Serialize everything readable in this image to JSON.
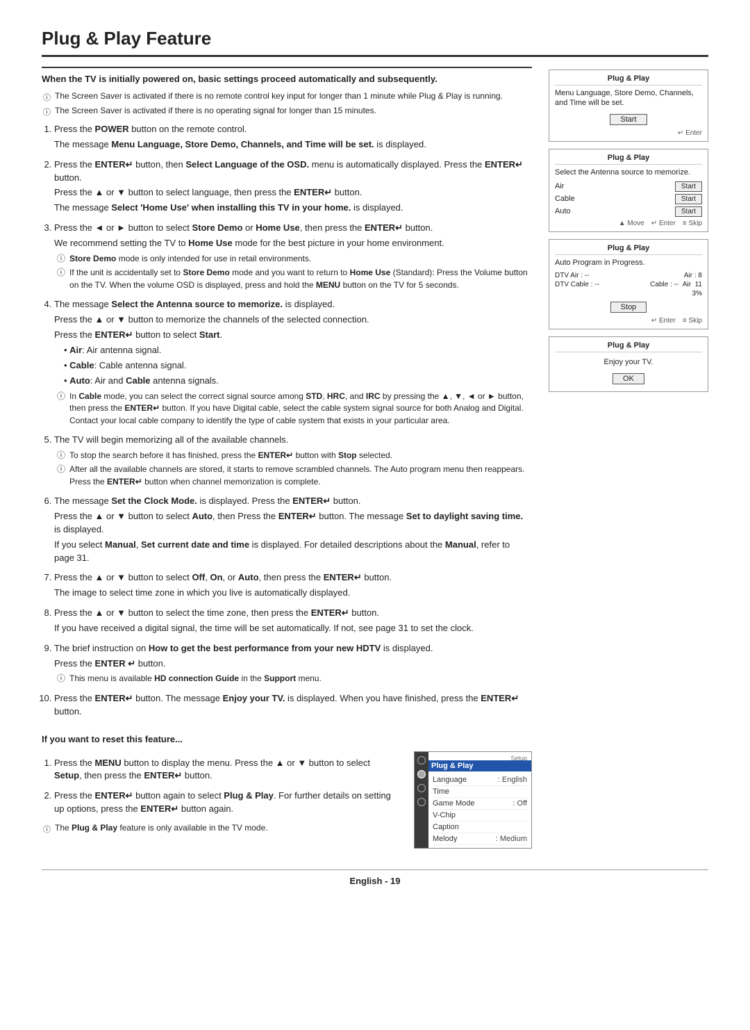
{
  "page": {
    "title": "Plug & Play Feature",
    "footer": "English - 19"
  },
  "intro": {
    "bold": "When the TV is initially powered on, basic settings proceed automatically and subsequently.",
    "notes": [
      "The Screen Saver is activated if there is no remote control key input for longer than 1 minute while Plug & Play is running.",
      "The Screen Saver is activated if there is no operating signal for longer than 15 minutes."
    ]
  },
  "steps": [
    {
      "num": "1",
      "lines": [
        "Press the POWER button on the remote control.",
        "The message Menu Language, Store Demo, Channels, and Time will be set. is displayed."
      ],
      "bold_parts": [
        "POWER",
        "Menu Language, Store Demo, Channels, and Time will be set."
      ]
    },
    {
      "num": "2",
      "lines": [
        "Press the ENTER button, then Select Language of the OSD. menu is automatically displayed. Press the ENTER button.",
        "Press the ▲ or ▼ button to select language, then press the ENTER button.",
        "The message Select 'Home Use' when installing this TV in your home. is displayed."
      ]
    },
    {
      "num": "3",
      "lines": [
        "Press the ◄ or ► button to select Store Demo or Home Use, then press the ENTER button.",
        "We recommend setting the TV to Home Use mode for the best picture in your home environment."
      ],
      "sub_notes": [
        "Store Demo mode is only intended for use in retail environments.",
        "If the unit is accidentally set to Store Demo mode and you want to return to Home Use (Standard): Press the Volume button on the TV. When the volume OSD is displayed, press and hold the MENU button on the TV for 5 seconds."
      ]
    },
    {
      "num": "4",
      "lines": [
        "The message Select the Antenna source to memorize. is displayed.",
        "Press the ▲ or ▼ button to memorize the channels of the selected connection.",
        "Press the ENTER button to select Start."
      ],
      "bullets": [
        "Air: Air antenna signal.",
        "Cable: Cable antenna signal.",
        "Auto: Air and Cable antenna signals."
      ],
      "sub_notes": [
        "In Cable mode, you can select the correct signal source among STD, HRC, and IRC by pressing the ▲, ▼, ◄ or ► button, then press the ENTER button. If you have Digital cable, select the cable system signal source for both Analog and Digital. Contact your local cable company to identify the type of cable system that exists in your particular area."
      ]
    },
    {
      "num": "5",
      "lines": [
        "The TV will begin memorizing all of the available channels."
      ],
      "sub_notes": [
        "To stop the search before it has finished, press the ENTER button with Stop selected.",
        "After all the available channels are stored, it starts to remove scrambled channels. The Auto program menu then reappears. Press the ENTER button when channel memorization is complete."
      ]
    },
    {
      "num": "6",
      "lines": [
        "The message Set the Clock Mode. is displayed. Press the ENTER button.",
        "Press the ▲ or ▼ button to select Auto, then Press the ENTER button. The message Set to daylight saving time. is displayed.",
        "If you select Manual, Set current date and time is displayed. For detailed descriptions about the Manual, refer to page 31."
      ]
    },
    {
      "num": "7",
      "lines": [
        "Press the ▲ or ▼ button to select Off, On, or Auto, then press the ENTER button.",
        "The image to select time zone in which you live is automatically displayed."
      ]
    },
    {
      "num": "8",
      "lines": [
        "Press the ▲ or ▼ button to select the time zone, then press the ENTER button.",
        "If you have received a digital signal, the time will be set automatically. If not, see page 31 to set the clock."
      ]
    },
    {
      "num": "9",
      "lines": [
        "The brief instruction on How to get the best performance from your new HDTV is displayed.",
        "Press the ENTER  button."
      ],
      "sub_notes": [
        "This menu is available HD connection Guide in the Support menu."
      ]
    },
    {
      "num": "10",
      "lines": [
        "Press the ENTER button. The message Enjoy your TV. is displayed. When you have finished, press the ENTER button."
      ]
    }
  ],
  "screens": {
    "screen1": {
      "title": "Plug & Play",
      "msg": "Menu Language, Store Demo, Channels, and Time will be set.",
      "btn": "Start",
      "nav": "Enter"
    },
    "screen2": {
      "title": "Plug & Play",
      "msg": "Select the Antenna source to memorize.",
      "rows": [
        {
          "label": "Air",
          "btn": "Start"
        },
        {
          "label": "Cable",
          "btn": "Start"
        },
        {
          "label": "Auto",
          "btn": "Start"
        }
      ],
      "nav": "Move   Enter   Skip"
    },
    "screen3": {
      "title": "Plug & Play",
      "msg": "Auto Program in Progress.",
      "progress_rows": [
        {
          "label": "DTV Air : --",
          "val": "Air : 8"
        },
        {
          "label": "DTV Cable : --",
          "val": "Cable : --   Air   11"
        }
      ],
      "percent": "3%",
      "btn": "Stop",
      "nav": "Enter   Skip"
    },
    "screen4": {
      "title": "Plug & Play",
      "msg": "Enjoy your TV.",
      "btn": "OK"
    }
  },
  "reset": {
    "title": "If you want to reset this feature...",
    "steps": [
      "Press the MENU button to display the menu. Press the ▲ or ▼ button to select Setup, then press the ENTER  button.",
      "Press the ENTER  button again to select Plug & Play. For further details on setting up options, press the ENTER  button again."
    ],
    "note": "The Plug & Play feature is only available in the TV mode.",
    "menu": {
      "sidebar_label": "Setup",
      "header": "Plug & Play",
      "rows": [
        {
          "label": "Language",
          "val": ": English"
        },
        {
          "label": "Time",
          "val": ""
        },
        {
          "label": "Game Mode",
          "val": ": Off"
        },
        {
          "label": "V-Chip",
          "val": ""
        },
        {
          "label": "Caption",
          "val": ""
        },
        {
          "label": "Melody",
          "val": ": Medium"
        }
      ]
    }
  }
}
